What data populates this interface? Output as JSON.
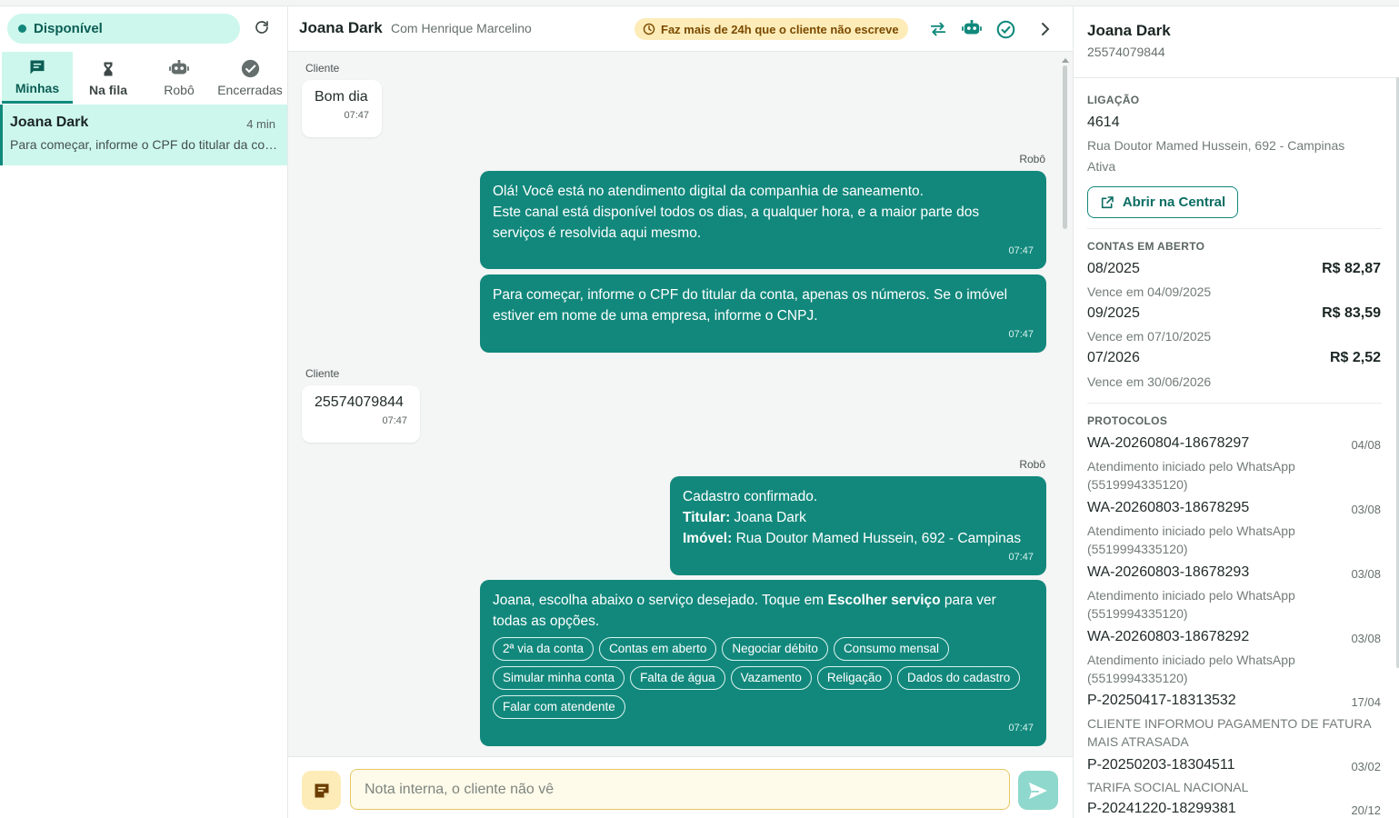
{
  "status": {
    "label": "Disponível",
    "color": "#12867a"
  },
  "tabs": [
    {
      "label": "Minhas",
      "icon": "chat-icon",
      "active": true
    },
    {
      "label": "Na fila",
      "icon": "hourglass-icon",
      "active": false
    },
    {
      "label": "Robô",
      "icon": "robot-icon",
      "active": false
    },
    {
      "label": "Encerradas",
      "icon": "check-circle-icon",
      "active": false
    }
  ],
  "conversation": {
    "name": "Joana Dark",
    "time": "4 min",
    "preview": "Para começar, informe o CPF do titular da conta, apenas os números."
  },
  "chat_header": {
    "name": "Joana Dark",
    "with": "Com Henrique Marcelino",
    "warning": "Faz mais de 24h que o cliente não escreve"
  },
  "messages": {
    "m1": {
      "sender": "Cliente",
      "text": "Bom dia",
      "time": "07:47"
    },
    "m2": {
      "sender": "Robô",
      "line1": "Olá! Você está no atendimento digital da companhia de saneamento.",
      "line2": "Este canal está disponível todos os dias, a qualquer hora, e a maior parte dos serviços é resolvida aqui mesmo.",
      "time": "07:47"
    },
    "m3": {
      "text": "Para começar, informe o CPF do titular da conta, apenas os números. Se o imóvel estiver em nome de uma empresa, informe o CNPJ.",
      "time": "07:47"
    },
    "m4": {
      "sender": "Cliente",
      "text": "25574079844",
      "time": "07:47"
    },
    "m5": {
      "sender": "Robô",
      "line1": "Cadastro confirmado.",
      "titular_label": "Titular:",
      "titular_value": " Joana Dark",
      "imovel_label": "Imóvel:",
      "imovel_value": " Rua Doutor Mamed Hussein, 692 - Campinas",
      "time": "07:47"
    },
    "m6": {
      "text_a": "Joana, escolha abaixo o serviço desejado. Toque em ",
      "text_bold": "Escolher serviço",
      "text_b": " para ver todas as opções.",
      "time": "07:47"
    }
  },
  "options": [
    "2ª via da conta",
    "Contas em aberto",
    "Negociar débito",
    "Consumo mensal",
    "Simular minha conta",
    "Falta de água",
    "Vazamento",
    "Religação",
    "Dados do cadastro",
    "Falar com atendente"
  ],
  "composer": {
    "placeholder": "Nota interna, o cliente não vê"
  },
  "customer": {
    "name": "Joana Dark",
    "cpf": "25574079844",
    "ligacao_title": "LIGAÇÃO",
    "ligacao_id": "4614",
    "address": "Rua Doutor Mamed Hussein, 692 - Campinas",
    "ligacao_status": "Ativa",
    "open_button": "Abrir na Central",
    "bills_title": "CONTAS EM ABERTO",
    "bills": [
      {
        "ref": "08/2025",
        "amount": "R$ 82,87",
        "due": "Vence em 04/09/2025"
      },
      {
        "ref": "09/2025",
        "amount": "R$ 83,59",
        "due": "Vence em 07/10/2025"
      },
      {
        "ref": "07/2026",
        "amount": "R$ 2,52",
        "due": "Vence em 30/06/2026"
      }
    ],
    "protocols_title": "PROTOCOLOS",
    "protocols": [
      {
        "id": "WA-20260804-18678297",
        "date": "04/08",
        "desc1": "Atendimento iniciado pelo WhatsApp",
        "desc2": "(5519994335120)"
      },
      {
        "id": "WA-20260803-18678295",
        "date": "03/08",
        "desc1": "Atendimento iniciado pelo WhatsApp",
        "desc2": "(5519994335120)"
      },
      {
        "id": "WA-20260803-18678293",
        "date": "03/08",
        "desc1": "Atendimento iniciado pelo WhatsApp",
        "desc2": "(5519994335120)"
      },
      {
        "id": "WA-20260803-18678292",
        "date": "03/08",
        "desc1": "Atendimento iniciado pelo WhatsApp",
        "desc2": "(5519994335120)"
      },
      {
        "id": "P-20250417-18313532",
        "date": "17/04",
        "desc1": "CLIENTE INFORMOU PAGAMENTO DE FATURA",
        "desc2": "MAIS ATRASADA"
      },
      {
        "id": "P-20250203-18304511",
        "date": "03/02",
        "desc1": "TARIFA SOCIAL NACIONAL",
        "desc2": ""
      },
      {
        "id": "P-20241220-18299381",
        "date": "20/12",
        "desc1": "",
        "desc2": ""
      }
    ]
  },
  "colors": {
    "brand": "#12887c",
    "brand_light": "#cdf7ec",
    "warning_bg": "#fdecb8"
  }
}
